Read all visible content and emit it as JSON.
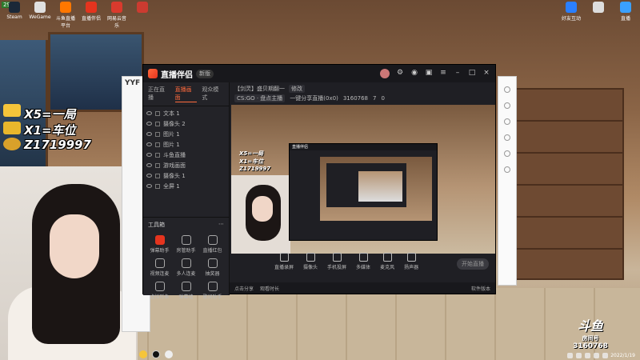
{
  "desktop": {
    "counter": "29",
    "icons_left": [
      {
        "label": "Steam",
        "color": "#1b2838"
      },
      {
        "label": "WeGame",
        "color": "#e0e0e0"
      },
      {
        "label": "斗鱼直播平台",
        "color": "#ff7700"
      },
      {
        "label": "直播伴侣",
        "color": "#e5341e"
      },
      {
        "label": "网易云音乐",
        "color": "#d93a2d"
      },
      {
        "label": "",
        "color": "#cc3b30"
      }
    ],
    "icons_right": [
      {
        "label": "好友互动",
        "color": "#2a7fff"
      },
      {
        "label": "",
        "color": "#ddd"
      },
      {
        "label": "直播",
        "color": "#3aa0ff"
      }
    ]
  },
  "overlay": {
    "line1": "X5=一局",
    "line2": "X1=车位",
    "line3": "Z1719997"
  },
  "yy_window": {
    "label": "YYF"
  },
  "app": {
    "name": "直播伴侣",
    "version": "新版",
    "left_tabs": [
      "正在直播",
      "直播画面",
      "观众模式"
    ],
    "scenes": [
      "文本 1",
      "摄像头 2",
      "图片 1",
      "图片 1",
      "斗鱼直播",
      "游戏画面",
      "摄像头 1",
      "全屏 1"
    ],
    "tools_title": "工具箱",
    "tools": [
      {
        "label": "弹幕助手",
        "hot": true
      },
      {
        "label": "房管助手",
        "hot": false
      },
      {
        "label": "直播红包",
        "hot": false
      },
      {
        "label": "视频连麦",
        "hot": false
      },
      {
        "label": "多人连麦",
        "hot": false
      },
      {
        "label": "抽奖器",
        "hot": false
      },
      {
        "label": "虚拟形象",
        "hot": false
      },
      {
        "label": "弹幕墙",
        "hot": false
      },
      {
        "label": "歌词助手",
        "hot": false
      }
    ],
    "room": {
      "title": "【剑灵】盛贝期翻一",
      "tag": "修改",
      "category": "CS:GO · 盘点主播",
      "stats": [
        "一键分享直播(0x0)",
        "3160768",
        "7",
        "0"
      ]
    },
    "preview_text": [
      "X5=一局",
      "X1=车位",
      "Z1719997"
    ],
    "nested_title": "直播伴侣",
    "controls": [
      "直播录屏",
      "摄像头",
      "手机投屏",
      "多媒体",
      "麦克风",
      "扬声器"
    ],
    "start_label": "开始直播",
    "status_left": "点击分享",
    "status_mid": "观看时长",
    "status_right": "软件版本",
    "bottom_left_icon": "tool-icon"
  },
  "douyu": {
    "logo": "斗鱼",
    "line2": "房间号",
    "room_id": "3160768"
  },
  "taskbar": {
    "clock": "2022/1/19"
  }
}
